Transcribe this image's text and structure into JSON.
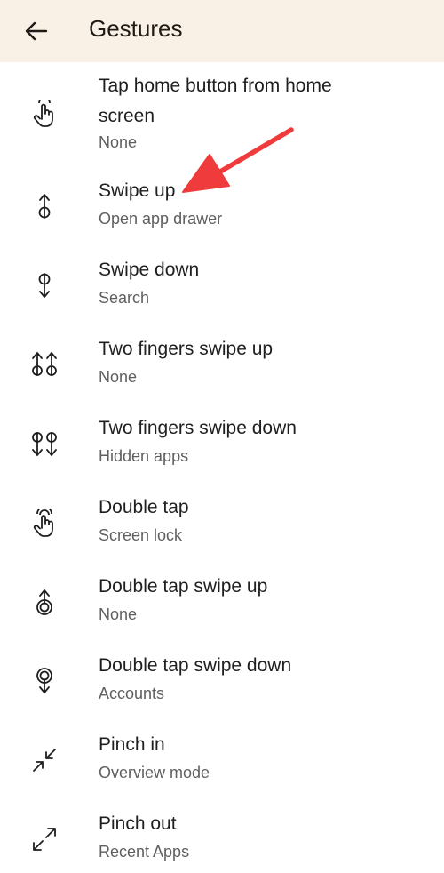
{
  "header": {
    "title": "Gestures",
    "back_icon": "arrow-left-icon",
    "background": "#f9f1e5"
  },
  "items": [
    {
      "title": "Tap home button from home screen",
      "subtitle": "None",
      "icon": "tap-hand-icon"
    },
    {
      "title": "Swipe up",
      "subtitle": "Open app drawer",
      "icon": "swipe-up-icon"
    },
    {
      "title": "Swipe down",
      "subtitle": "Search",
      "icon": "swipe-down-icon"
    },
    {
      "title": "Two fingers swipe up",
      "subtitle": "None",
      "icon": "two-finger-swipe-up-icon"
    },
    {
      "title": "Two fingers swipe down",
      "subtitle": "Hidden apps",
      "icon": "two-finger-swipe-down-icon"
    },
    {
      "title": "Double tap",
      "subtitle": "Screen lock",
      "icon": "double-tap-hand-icon"
    },
    {
      "title": "Double tap swipe up",
      "subtitle": "None",
      "icon": "double-tap-swipe-up-icon"
    },
    {
      "title": "Double tap swipe down",
      "subtitle": "Accounts",
      "icon": "double-tap-swipe-down-icon"
    },
    {
      "title": "Pinch in",
      "subtitle": "Overview mode",
      "icon": "pinch-in-icon"
    },
    {
      "title": "Pinch out",
      "subtitle": "Recent Apps",
      "icon": "pinch-out-icon"
    }
  ],
  "annotation": {
    "icon": "red-arrow-annotation",
    "color": "#ef3b3b"
  }
}
